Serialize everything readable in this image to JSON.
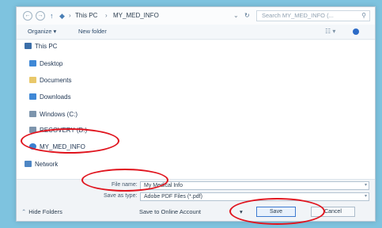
{
  "window": {
    "nav": {
      "back_icon": "back-arrow-icon",
      "forward_icon": "forward-arrow-icon",
      "up_icon": "up-arrow-icon"
    },
    "breadcrumb": [
      "This PC",
      "MY_MED_INFO"
    ],
    "search_placeholder": "Search MY_MED_INFO (...",
    "refresh_glyph": "↻"
  },
  "toolbar": {
    "organize_label": "Organize ▾",
    "new_folder_label": "New folder"
  },
  "tree": [
    {
      "label": "This PC",
      "icon": "computer-icon"
    },
    {
      "label": "Desktop",
      "icon": "desktop-folder-icon"
    },
    {
      "label": "Documents",
      "icon": "documents-folder-icon"
    },
    {
      "label": "Downloads",
      "icon": "downloads-folder-icon"
    },
    {
      "label": "Windows (C:)",
      "icon": "drive-icon"
    },
    {
      "label": "RECOVERY (D:)",
      "icon": "drive-icon"
    },
    {
      "label": "MY_MED_INFO",
      "icon": "usb-drive-icon"
    },
    {
      "label": "Network",
      "icon": "network-icon"
    }
  ],
  "fields": {
    "filename_label": "File name:",
    "filename_value": "My Medical Info",
    "savetype_label": "Save as type:",
    "savetype_value": "Adobe PDF Files (*.pdf)"
  },
  "footer": {
    "hide_folders": "Hide Folders",
    "save_online": "Save to Online Account",
    "save_label": "Save",
    "cancel_label": "Cancel"
  },
  "colors": {
    "annotation_circle": "#e0141e",
    "background": "#7ec3df"
  }
}
